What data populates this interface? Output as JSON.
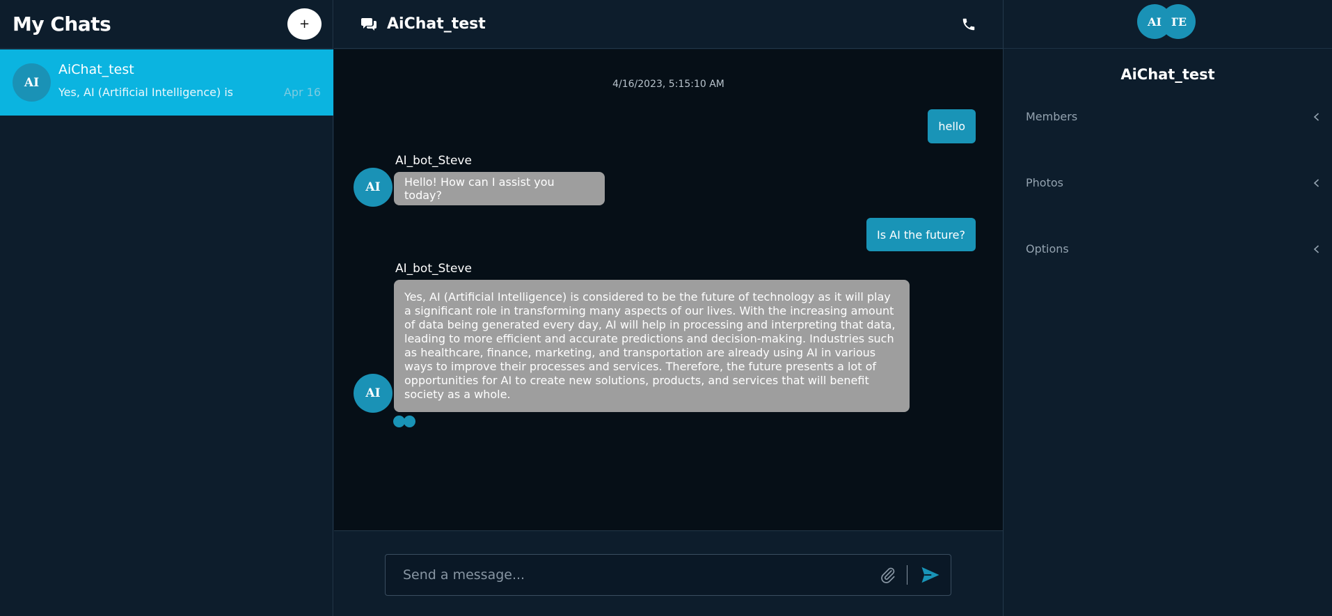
{
  "sidebar": {
    "title": "My Chats",
    "new_chat_label": "+",
    "chats": [
      {
        "avatar": "AI",
        "name": "AiChat_test",
        "preview": "Yes, AI (Artificial Intelligence) is considered to be the future of technology",
        "date": "Apr 16",
        "active": true
      }
    ]
  },
  "chat": {
    "title": "AiChat_test",
    "timestamp": "4/16/2023, 5:15:10 AM",
    "messages": [
      {
        "direction": "out",
        "text": "hello"
      },
      {
        "direction": "in",
        "sender": "AI_bot_Steve",
        "avatar": "AI",
        "text": "Hello! How can I assist you today?"
      },
      {
        "direction": "out",
        "text": "Is AI the future?"
      },
      {
        "direction": "in",
        "sender": "AI_bot_Steve",
        "avatar": "AI",
        "text": "Yes, AI (Artificial Intelligence) is considered to be the future of technology as it will play a significant role in transforming many aspects of our lives. With the increasing amount of data being generated every day, AI will help in processing and interpreting that data, leading to more efficient and accurate predictions and decision-making. Industries such as healthcare, finance, marketing, and transportation are already using AI in various ways to improve their processes and services. Therefore, the future presents a lot of opportunities for AI to create new solutions, products, and services that will benefit society as a whole."
      }
    ],
    "composer": {
      "placeholder": "Send a message..."
    }
  },
  "details": {
    "member_avatars": [
      "AI",
      "TE"
    ],
    "title": "AiChat_test",
    "sections": [
      "Members",
      "Photos",
      "Options"
    ]
  },
  "colors": {
    "accent": "#1994b7",
    "active_chat": "#0bb4e0",
    "incoming_bubble": "#9e9e9e",
    "background": "#0d1d2c"
  },
  "icons": {
    "header": "chat-bubbles-icon",
    "call": "phone-icon",
    "attach": "paperclip-icon",
    "send": "send-icon",
    "collapse": "chevron-left-icon"
  }
}
